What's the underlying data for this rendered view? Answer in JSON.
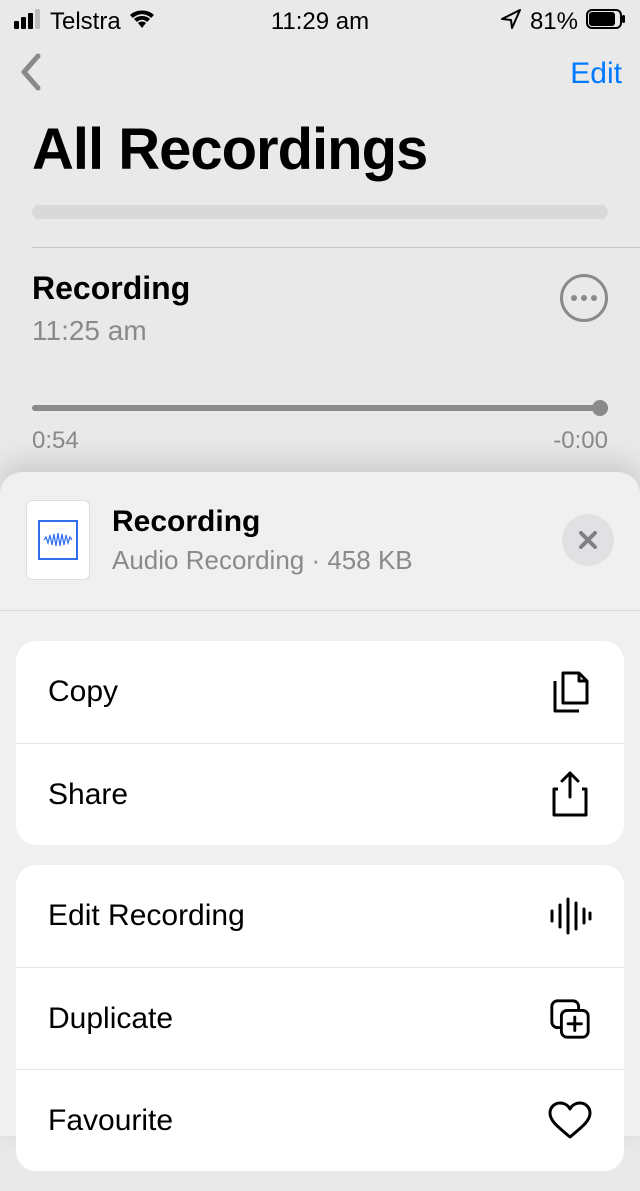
{
  "status": {
    "carrier": "Telstra",
    "time": "11:29 am",
    "battery_pct": "81%"
  },
  "nav": {
    "edit": "Edit"
  },
  "page": {
    "title": "All Recordings"
  },
  "recording": {
    "name": "Recording",
    "time": "11:25 am",
    "elapsed": "0:54",
    "remaining": "-0:00"
  },
  "sheet": {
    "name": "Recording",
    "subtitle": "Audio Recording · 458 KB",
    "group1": {
      "copy": "Copy",
      "share": "Share"
    },
    "group2": {
      "edit": "Edit Recording",
      "duplicate": "Duplicate",
      "favourite": "Favourite"
    }
  }
}
